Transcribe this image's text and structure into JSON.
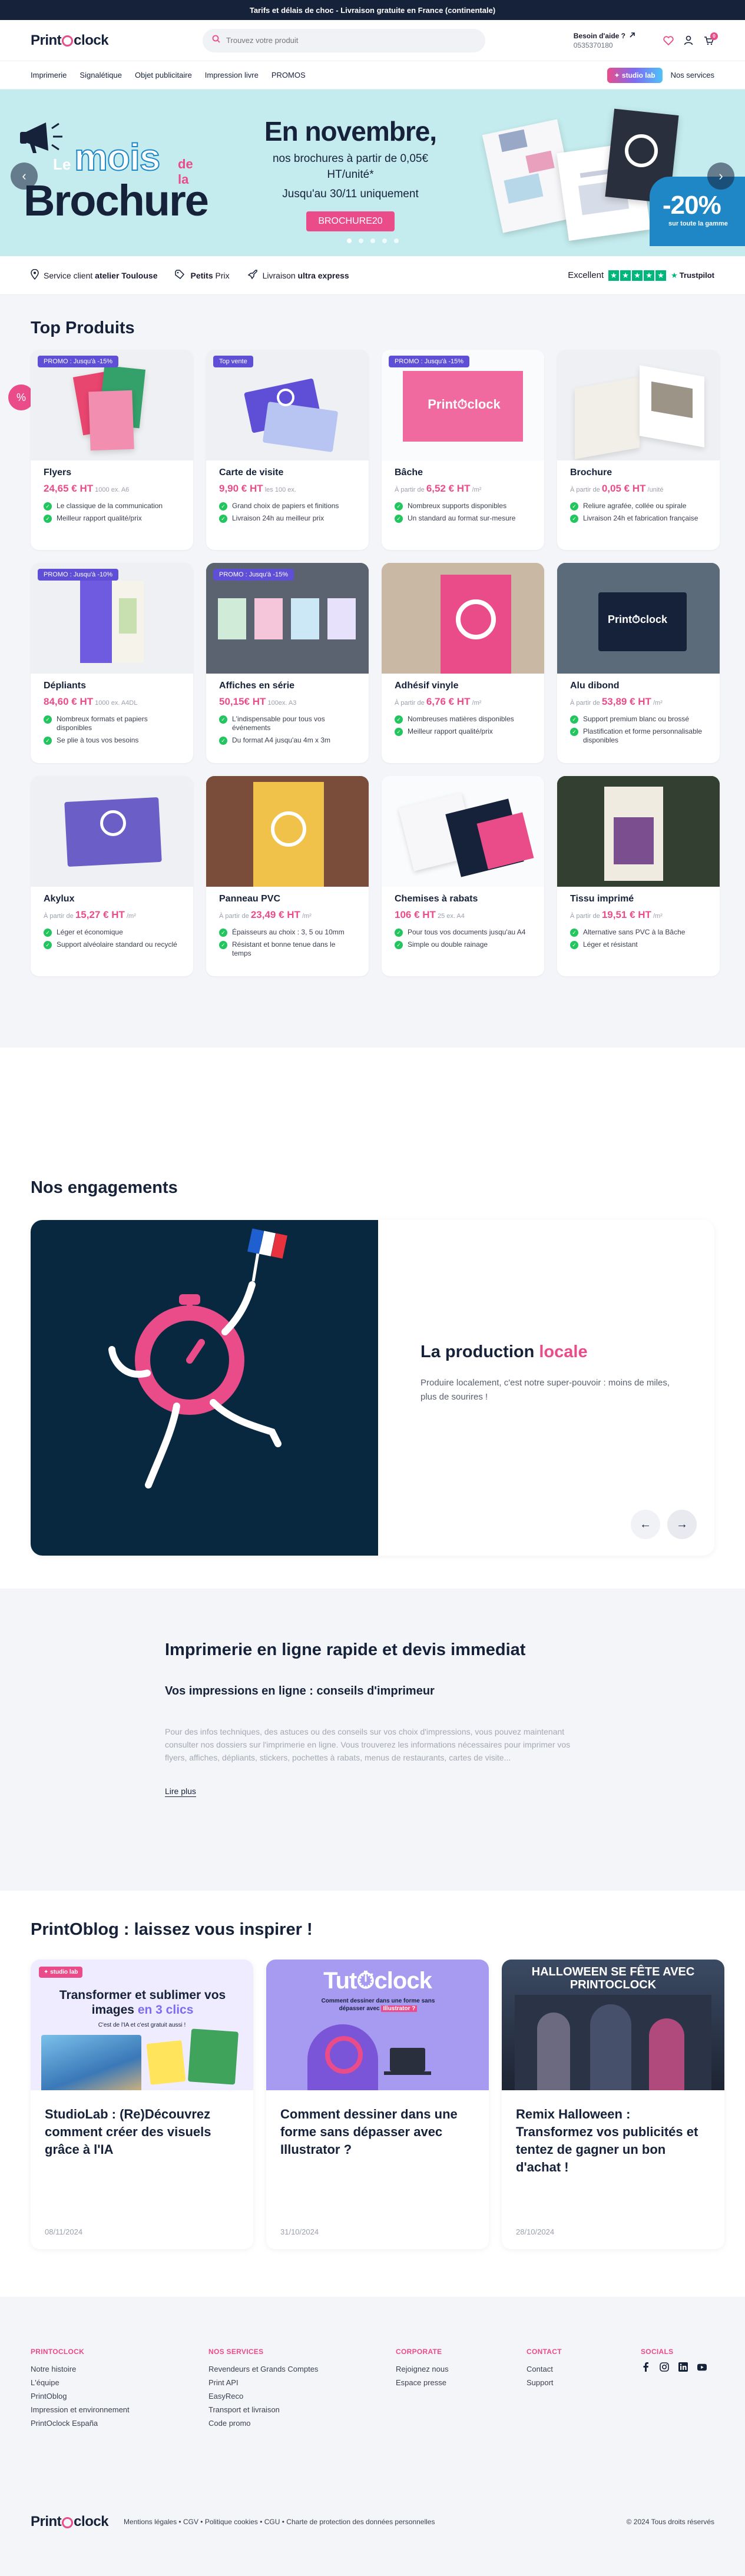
{
  "topbar": {
    "text": "Tarifs et délais de choc - Livraison gratuite en France (continentale)"
  },
  "header": {
    "logo": "Print⏱clock",
    "logo_left": "Print",
    "logo_right": "clock",
    "search_placeholder": "Trouvez votre produit",
    "help_title": "Besoin d'aide ?",
    "help_phone": "0535370180",
    "cart_count": "0"
  },
  "nav": {
    "items": [
      "Imprimerie",
      "Signalétique",
      "Objet publicitaire",
      "Impression livre",
      "PROMOS"
    ],
    "studio": "✦ studio lab",
    "services": "Nos services"
  },
  "hero": {
    "le": "Le",
    "mois": "mois",
    "dela": "de la",
    "brochure": "Brochure",
    "headline": "En novembre,",
    "sub1": "nos brochures à partir de 0,05€ HT/unité*",
    "sub2": "Jusqu'au 30/11 uniquement",
    "code": "BROCHURE20",
    "discount": "-20%",
    "discount_caption": "sur toute la gamme"
  },
  "reassure": {
    "items": [
      {
        "pre": "Service client ",
        "bold": "atelier Toulouse",
        "post": ""
      },
      {
        "pre": "",
        "bold": "Petits",
        "post": " Prix"
      },
      {
        "pre": "Livraison ",
        "bold": "ultra express",
        "post": ""
      }
    ],
    "tp_label": "Excellent",
    "tp_brand": "Trustpilot"
  },
  "products": {
    "title": "Top Produits",
    "items": [
      {
        "name": "Flyers",
        "tag": "PROMO : Jusqu'à -15%",
        "from": "",
        "price": "24,65 € HT",
        "qty": "1000 ex. A6",
        "features": [
          "Le classique de la communication",
          "Meilleur rapport qualité/prix"
        ]
      },
      {
        "name": "Carte de visite",
        "tag": "Top vente",
        "from": "",
        "price": "9,90 € HT",
        "qty": "les 100 ex.",
        "features": [
          "Grand choix de papiers et finitions",
          "Livraison 24h au meilleur prix"
        ]
      },
      {
        "name": "Bâche",
        "tag": "PROMO : Jusqu'à -15%",
        "from": "À partir de ",
        "price": "6,52 € HT",
        "qty": "/m²",
        "features": [
          "Nombreux supports disponibles",
          "Un standard au format sur-mesure"
        ]
      },
      {
        "name": "Brochure",
        "tag": "",
        "from": "À partir de ",
        "price": "0,05 € HT",
        "qty": "/unité",
        "features": [
          "Reliure agrafée, collée ou spirale",
          "Livraison 24h et fabrication française"
        ]
      },
      {
        "name": "Dépliants",
        "tag": "PROMO : Jusqu'à -10%",
        "from": "",
        "price": "84,60 € HT",
        "qty": "1000 ex. A4DL",
        "features": [
          "Nombreux formats et papiers disponibles",
          "Se plie à tous vos besoins"
        ]
      },
      {
        "name": "Affiches en série",
        "tag": "PROMO : Jusqu'à -15%",
        "from": "",
        "price": "50,15€ HT",
        "qty": "100ex. A3",
        "features": [
          "L'indispensable pour tous vos événements",
          "Du format A4 jusqu'au 4m x 3m"
        ]
      },
      {
        "name": "Adhésif vinyle",
        "tag": "",
        "from": "À partir de ",
        "price": "6,76 € HT",
        "qty": "/m²",
        "features": [
          "Nombreuses matières disponibles",
          "Meilleur rapport qualité/prix"
        ]
      },
      {
        "name": "Alu dibond",
        "tag": "",
        "from": "À partir de ",
        "price": "53,89 € HT",
        "qty": "/m²",
        "features": [
          "Support premium blanc ou brossé",
          "Plastification et forme personnalisable disponibles"
        ]
      },
      {
        "name": "Akylux",
        "tag": "",
        "from": "À partir de ",
        "price": "15,27 € HT",
        "qty": "/m²",
        "features": [
          "Léger et économique",
          "Support alvéolaire standard ou recyclé"
        ]
      },
      {
        "name": "Panneau PVC",
        "tag": "",
        "from": "À partir de ",
        "price": "23,49 € HT",
        "qty": "/m²",
        "features": [
          "Épaisseurs au choix : 3, 5 ou 10mm",
          "Résistant et bonne tenue dans le temps"
        ]
      },
      {
        "name": "Chemises à rabats",
        "tag": "",
        "from": "",
        "price": "106 € HT",
        "qty": "25 ex. A4",
        "features": [
          "Pour tous vos documents jusqu'au A4",
          "Simple ou double rainage"
        ]
      },
      {
        "name": "Tissu imprimé",
        "tag": "",
        "from": "À partir de ",
        "price": "19,51 € HT",
        "qty": "/m²",
        "features": [
          "Alternative sans PVC à la Bâche",
          "Léger et résistant"
        ]
      }
    ]
  },
  "engagements": {
    "title": "Nos engagements",
    "heading_pre": "La production ",
    "heading_accent": "locale",
    "text": "Produire localement, c'est notre super-pouvoir : moins de miles, plus de sourires !"
  },
  "seo": {
    "title": "Imprimerie en ligne rapide et devis immediat",
    "subtitle": "Vos impressions en ligne : conseils d'imprimeur",
    "text": "Pour des infos techniques, des astuces ou des conseils sur vos choix d'impressions, vous pouvez maintenant consulter nos dossiers sur l'imprimerie en ligne. Vous trouverez les informations nécessaires pour imprimer vos flyers, affiches, dépliants, stickers, pochettes à rabats, menus de restaurants, cartes de visite...",
    "more": "Lire plus"
  },
  "blog": {
    "title": "PrintOblog : laissez vous inspirer !",
    "posts": [
      {
        "title": "StudioLab : (Re)Découvrez comment créer des visuels grâce à l'IA",
        "date": "08/11/2024",
        "img_title": "Transformer et sublimer vos images",
        "img_accent": "en 3 clics",
        "img_sub": "C'est de l'IA et c'est gratuit aussi !",
        "img_badge": "✦ studio lab"
      },
      {
        "title": "Comment dessiner dans une forme sans dépasser avec Illustrator ?",
        "date": "31/10/2024",
        "img_title": "Tut⏱clock",
        "img_sub": "Comment dessiner dans une forme sans dépasser avec",
        "img_accent": "Illustrator ?"
      },
      {
        "title": "Remix Halloween : Transformez vos publicités et tentez de gagner un bon d'achat !",
        "date": "28/10/2024",
        "img_title": "HALLOWEEN SE FÊTE AVEC PRINTOCLOCK"
      }
    ]
  },
  "footer": {
    "columns": [
      {
        "title": "PRINTOCLOCK",
        "links": [
          "Notre histoire",
          "L'équipe",
          "PrintOblog",
          "Impression et environnement",
          "PrintOclock España"
        ]
      },
      {
        "title": "NOS SERVICES",
        "links": [
          "Revendeurs et Grands Comptes",
          "Print API",
          "EasyReco",
          "Transport et livraison",
          "Code promo"
        ]
      },
      {
        "title": "CORPORATE",
        "links": [
          "Rejoignez nous",
          "Espace presse"
        ]
      },
      {
        "title": "CONTACT",
        "links": [
          "Contact",
          "Support"
        ]
      },
      {
        "title": "SOCIALS",
        "links": []
      }
    ],
    "legal": "Mentions légales • CGV • Politique cookies • CGU • Charte de protection des données personnelles",
    "copyright": "© 2024 Tous droits réservés"
  },
  "colors": {
    "navy": "#16213a",
    "pink": "#ea4c89",
    "violet": "#5f4ed6",
    "teal": "#c4ecee",
    "green": "#22c55e",
    "trustpilot": "#00b67a"
  }
}
